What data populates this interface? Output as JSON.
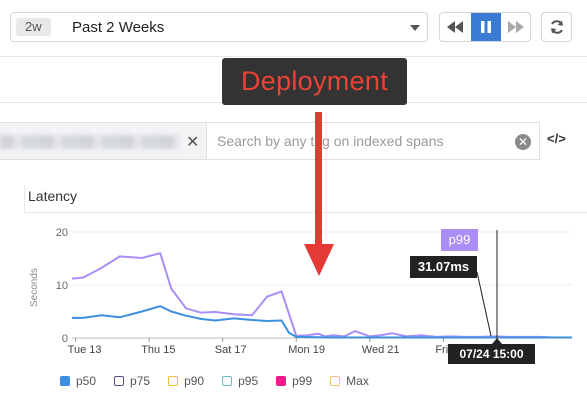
{
  "toolbar": {
    "time_badge": "2w",
    "time_label": "Past 2 Weeks"
  },
  "search": {
    "placeholder": "Search by any tag on indexed spans"
  },
  "panel": {
    "title": "Latency"
  },
  "annotation": {
    "label": "Deployment",
    "label_color": "#ea4335",
    "arrow_color": "#e53935"
  },
  "tooltip": {
    "series": "p99",
    "value": "31.07ms",
    "time": "07/24 15:00"
  },
  "chart_data": {
    "type": "line",
    "ylabel": "Seconds",
    "ylim": [
      0,
      20
    ],
    "yticks": [
      0,
      10,
      20
    ],
    "xticks": [
      "Tue 13",
      "Thu 15",
      "Sat 17",
      "Mon 19",
      "Wed 21",
      "Fri 23"
    ],
    "x_range_days": [
      12.9,
      26.5
    ],
    "series": [
      {
        "name": "p99",
        "color": "#a98ef5",
        "x": [
          12.9,
          13.2,
          13.7,
          14.2,
          14.8,
          15.3,
          15.6,
          16.0,
          16.4,
          16.8,
          17.3,
          17.8,
          18.2,
          18.6,
          19.0,
          19.3,
          19.6,
          19.8,
          20.0,
          20.3,
          20.6,
          21.0,
          21.3,
          21.6,
          22.0,
          22.4,
          22.8,
          23.2,
          23.6,
          24.0,
          24.4,
          24.8,
          25.2,
          25.6,
          26.0,
          26.5
        ],
        "y": [
          11.2,
          11.4,
          13.2,
          15.4,
          15.1,
          16.0,
          9.3,
          5.6,
          4.8,
          4.9,
          4.5,
          4.3,
          7.8,
          8.8,
          0.4,
          0.5,
          0.8,
          0.3,
          0.5,
          0.3,
          1.3,
          0.3,
          0.5,
          0.9,
          0.3,
          0.5,
          0.2,
          0.3,
          0.2,
          0.2,
          0.3,
          0.2,
          0.2,
          0.2,
          0.1,
          0.1
        ]
      },
      {
        "name": "p50",
        "color": "#3d8fe0",
        "x": [
          12.9,
          13.2,
          13.7,
          14.2,
          14.8,
          15.3,
          15.6,
          16.0,
          16.4,
          16.8,
          17.3,
          17.8,
          18.2,
          18.6,
          18.8,
          19.0,
          20.0,
          21.0,
          22.0,
          23.0,
          24.0,
          25.0,
          26.5
        ],
        "y": [
          3.8,
          3.8,
          4.3,
          3.9,
          5.0,
          6.0,
          5.0,
          4.2,
          3.6,
          3.3,
          3.7,
          3.4,
          3.2,
          3.3,
          1.0,
          0.2,
          0.1,
          0.1,
          0.1,
          0.1,
          0.1,
          0.1,
          0.1
        ]
      }
    ],
    "legend": [
      {
        "name": "p50",
        "color": "#3d8fe0",
        "filled": true
      },
      {
        "name": "p75",
        "color": "#5a4a8a",
        "filled": false
      },
      {
        "name": "p90",
        "color": "#e8c23a",
        "filled": false
      },
      {
        "name": "p95",
        "color": "#6cc1c7",
        "filled": false
      },
      {
        "name": "p99",
        "color": "#e91e8c",
        "filled": true
      },
      {
        "name": "Max",
        "color": "#f0c36d",
        "filled": false
      }
    ]
  }
}
